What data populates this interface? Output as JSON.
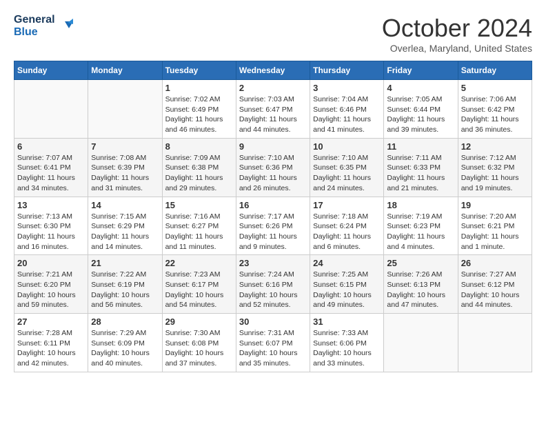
{
  "logo": {
    "text1": "General",
    "text2": "Blue"
  },
  "title": {
    "month": "October 2024",
    "location": "Overlea, Maryland, United States"
  },
  "weekdays": [
    "Sunday",
    "Monday",
    "Tuesday",
    "Wednesday",
    "Thursday",
    "Friday",
    "Saturday"
  ],
  "weeks": [
    [
      {
        "day": "",
        "info": ""
      },
      {
        "day": "",
        "info": ""
      },
      {
        "day": "1",
        "info": "Sunrise: 7:02 AM\nSunset: 6:49 PM\nDaylight: 11 hours and 46 minutes."
      },
      {
        "day": "2",
        "info": "Sunrise: 7:03 AM\nSunset: 6:47 PM\nDaylight: 11 hours and 44 minutes."
      },
      {
        "day": "3",
        "info": "Sunrise: 7:04 AM\nSunset: 6:46 PM\nDaylight: 11 hours and 41 minutes."
      },
      {
        "day": "4",
        "info": "Sunrise: 7:05 AM\nSunset: 6:44 PM\nDaylight: 11 hours and 39 minutes."
      },
      {
        "day": "5",
        "info": "Sunrise: 7:06 AM\nSunset: 6:42 PM\nDaylight: 11 hours and 36 minutes."
      }
    ],
    [
      {
        "day": "6",
        "info": "Sunrise: 7:07 AM\nSunset: 6:41 PM\nDaylight: 11 hours and 34 minutes."
      },
      {
        "day": "7",
        "info": "Sunrise: 7:08 AM\nSunset: 6:39 PM\nDaylight: 11 hours and 31 minutes."
      },
      {
        "day": "8",
        "info": "Sunrise: 7:09 AM\nSunset: 6:38 PM\nDaylight: 11 hours and 29 minutes."
      },
      {
        "day": "9",
        "info": "Sunrise: 7:10 AM\nSunset: 6:36 PM\nDaylight: 11 hours and 26 minutes."
      },
      {
        "day": "10",
        "info": "Sunrise: 7:10 AM\nSunset: 6:35 PM\nDaylight: 11 hours and 24 minutes."
      },
      {
        "day": "11",
        "info": "Sunrise: 7:11 AM\nSunset: 6:33 PM\nDaylight: 11 hours and 21 minutes."
      },
      {
        "day": "12",
        "info": "Sunrise: 7:12 AM\nSunset: 6:32 PM\nDaylight: 11 hours and 19 minutes."
      }
    ],
    [
      {
        "day": "13",
        "info": "Sunrise: 7:13 AM\nSunset: 6:30 PM\nDaylight: 11 hours and 16 minutes."
      },
      {
        "day": "14",
        "info": "Sunrise: 7:15 AM\nSunset: 6:29 PM\nDaylight: 11 hours and 14 minutes."
      },
      {
        "day": "15",
        "info": "Sunrise: 7:16 AM\nSunset: 6:27 PM\nDaylight: 11 hours and 11 minutes."
      },
      {
        "day": "16",
        "info": "Sunrise: 7:17 AM\nSunset: 6:26 PM\nDaylight: 11 hours and 9 minutes."
      },
      {
        "day": "17",
        "info": "Sunrise: 7:18 AM\nSunset: 6:24 PM\nDaylight: 11 hours and 6 minutes."
      },
      {
        "day": "18",
        "info": "Sunrise: 7:19 AM\nSunset: 6:23 PM\nDaylight: 11 hours and 4 minutes."
      },
      {
        "day": "19",
        "info": "Sunrise: 7:20 AM\nSunset: 6:21 PM\nDaylight: 11 hours and 1 minute."
      }
    ],
    [
      {
        "day": "20",
        "info": "Sunrise: 7:21 AM\nSunset: 6:20 PM\nDaylight: 10 hours and 59 minutes."
      },
      {
        "day": "21",
        "info": "Sunrise: 7:22 AM\nSunset: 6:19 PM\nDaylight: 10 hours and 56 minutes."
      },
      {
        "day": "22",
        "info": "Sunrise: 7:23 AM\nSunset: 6:17 PM\nDaylight: 10 hours and 54 minutes."
      },
      {
        "day": "23",
        "info": "Sunrise: 7:24 AM\nSunset: 6:16 PM\nDaylight: 10 hours and 52 minutes."
      },
      {
        "day": "24",
        "info": "Sunrise: 7:25 AM\nSunset: 6:15 PM\nDaylight: 10 hours and 49 minutes."
      },
      {
        "day": "25",
        "info": "Sunrise: 7:26 AM\nSunset: 6:13 PM\nDaylight: 10 hours and 47 minutes."
      },
      {
        "day": "26",
        "info": "Sunrise: 7:27 AM\nSunset: 6:12 PM\nDaylight: 10 hours and 44 minutes."
      }
    ],
    [
      {
        "day": "27",
        "info": "Sunrise: 7:28 AM\nSunset: 6:11 PM\nDaylight: 10 hours and 42 minutes."
      },
      {
        "day": "28",
        "info": "Sunrise: 7:29 AM\nSunset: 6:09 PM\nDaylight: 10 hours and 40 minutes."
      },
      {
        "day": "29",
        "info": "Sunrise: 7:30 AM\nSunset: 6:08 PM\nDaylight: 10 hours and 37 minutes."
      },
      {
        "day": "30",
        "info": "Sunrise: 7:31 AM\nSunset: 6:07 PM\nDaylight: 10 hours and 35 minutes."
      },
      {
        "day": "31",
        "info": "Sunrise: 7:33 AM\nSunset: 6:06 PM\nDaylight: 10 hours and 33 minutes."
      },
      {
        "day": "",
        "info": ""
      },
      {
        "day": "",
        "info": ""
      }
    ]
  ]
}
